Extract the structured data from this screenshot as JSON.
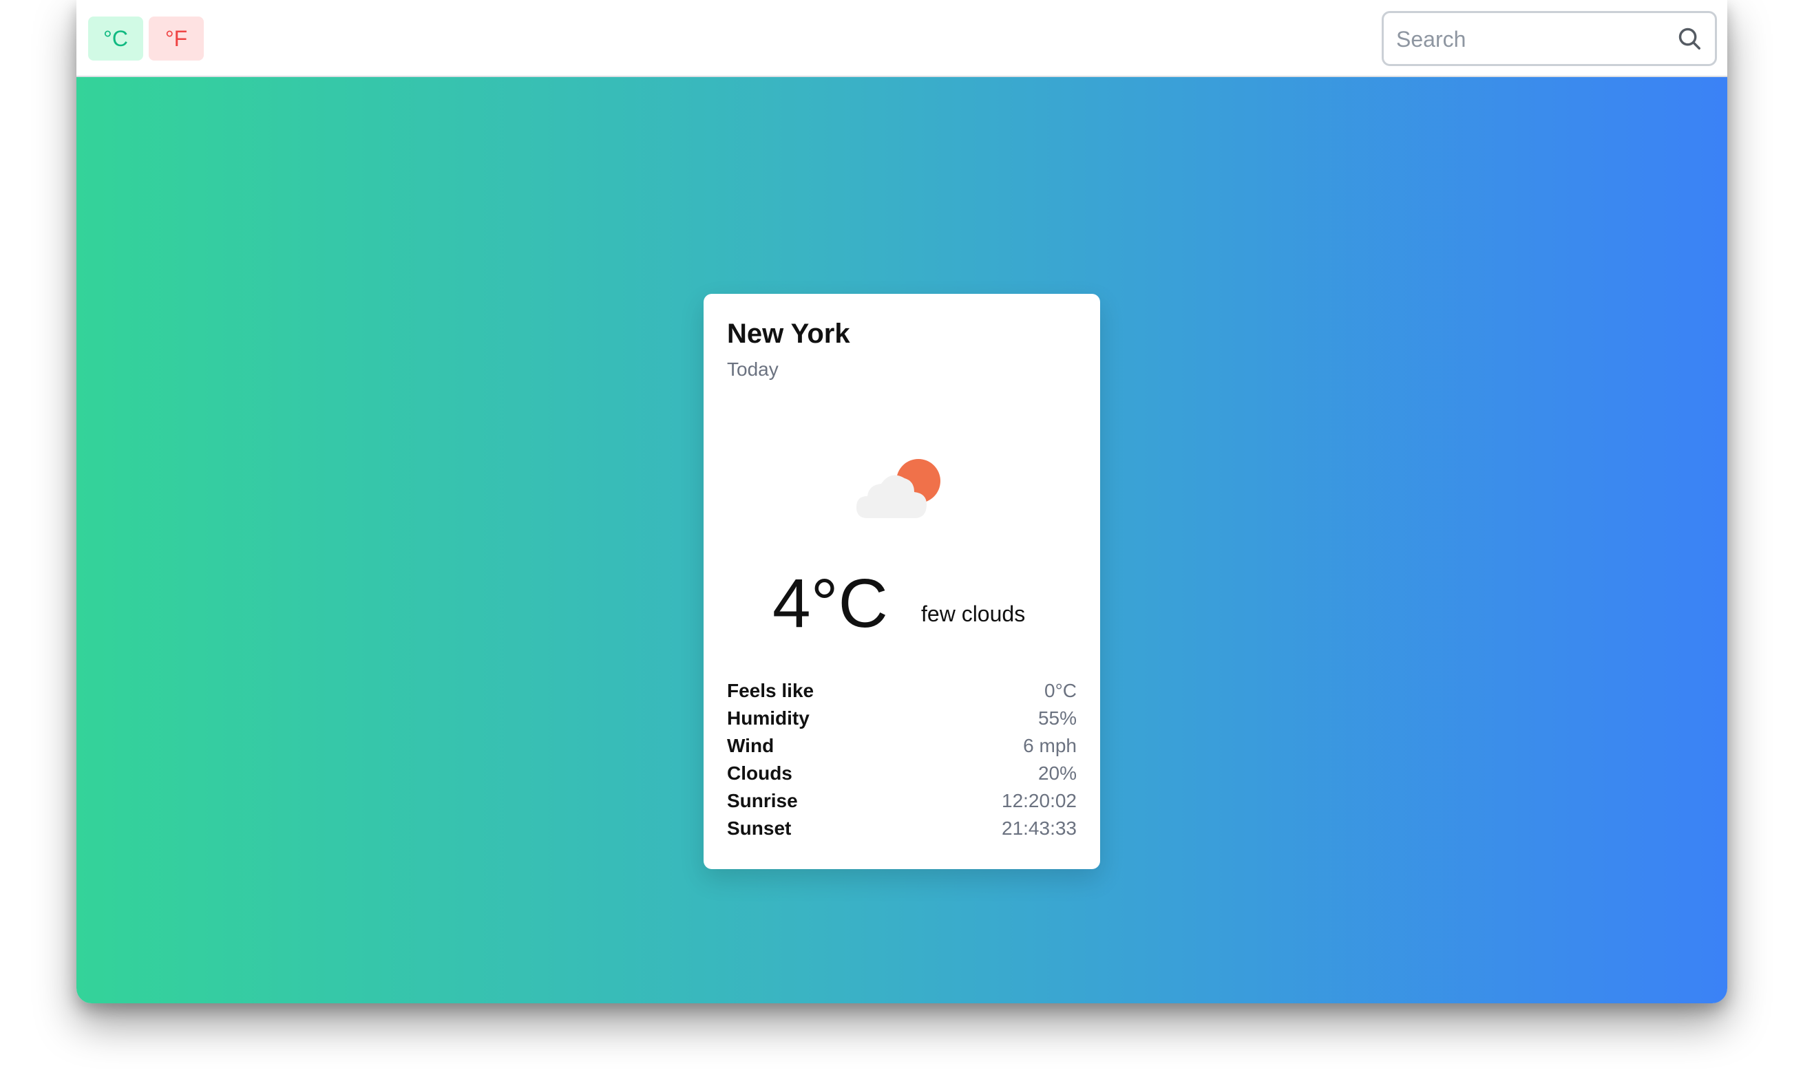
{
  "units": {
    "celsius_label": "°C",
    "fahrenheit_label": "°F"
  },
  "search": {
    "placeholder": "Search",
    "value": ""
  },
  "card": {
    "city": "New York",
    "day": "Today",
    "icon": "few-clouds-icon",
    "temperature": "4°C",
    "condition": "few clouds",
    "stats": [
      {
        "label": "Feels like",
        "value": "0°C"
      },
      {
        "label": "Humidity",
        "value": "55%"
      },
      {
        "label": "Wind",
        "value": "6 mph"
      },
      {
        "label": "Clouds",
        "value": "20%"
      },
      {
        "label": "Sunrise",
        "value": "12:20:02"
      },
      {
        "label": "Sunset",
        "value": "21:43:33"
      }
    ]
  },
  "colors": {
    "gradient_start": "#34d399",
    "gradient_end": "#3b82f6",
    "celsius_bg": "#d1fae5",
    "celsius_text": "#10b981",
    "fahrenheit_bg": "#fee2e2",
    "fahrenheit_text": "#ef4444",
    "sun": "#f0714a",
    "cloud": "#f1f1f1"
  }
}
